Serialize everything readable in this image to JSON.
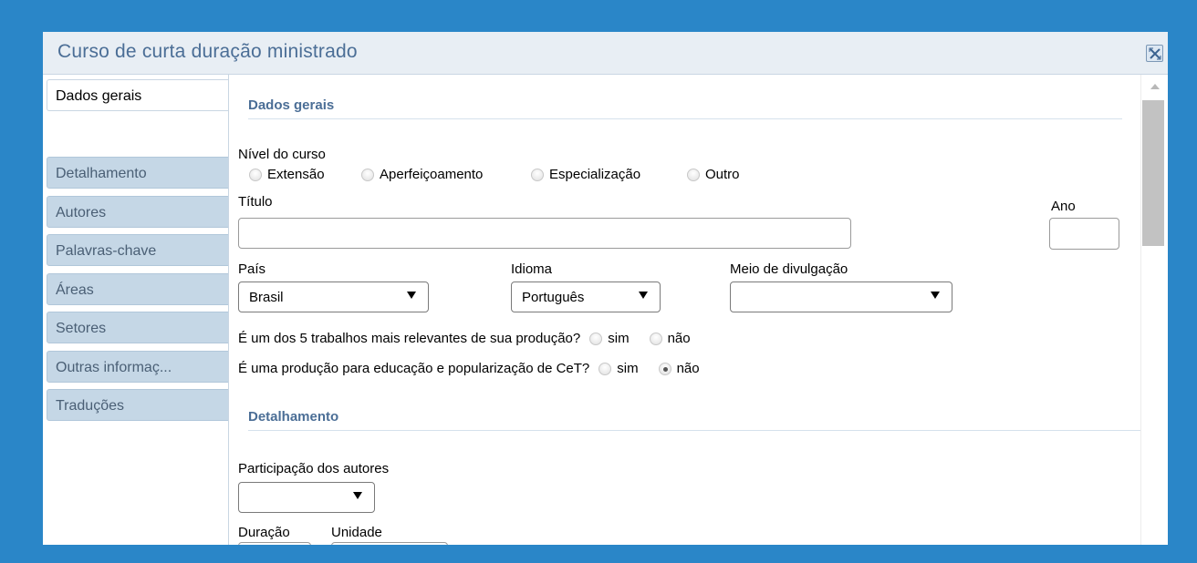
{
  "window": {
    "title": "Curso de curta duração ministrado"
  },
  "sidebar": {
    "tabs": [
      {
        "label": "Dados gerais"
      },
      {
        "label": "Detalhamento"
      },
      {
        "label": "Autores"
      },
      {
        "label": "Palavras-chave"
      },
      {
        "label": "Áreas"
      },
      {
        "label": "Setores"
      },
      {
        "label": "Outras informaç..."
      },
      {
        "label": "Traduções"
      }
    ]
  },
  "dados_gerais": {
    "section_title": "Dados gerais",
    "nivel": {
      "label": "Nível do curso",
      "options": [
        "Extensão",
        "Aperfeiçoamento",
        "Especialização",
        "Outro"
      ]
    },
    "titulo": {
      "label": "Título",
      "value": ""
    },
    "ano": {
      "label": "Ano",
      "value": ""
    },
    "pais": {
      "label": "País",
      "value": "Brasil"
    },
    "idioma": {
      "label": "Idioma",
      "value": "Português"
    },
    "meio": {
      "label": "Meio de divulgação",
      "value": ""
    },
    "relevantes": {
      "question": "É um dos 5 trabalhos mais relevantes de sua produção?",
      "yes": "sim",
      "no": "não",
      "selected": null
    },
    "educacao": {
      "question": "É uma produção para educação e popularização de CeT?",
      "yes": "sim",
      "no": "não",
      "selected": "não"
    }
  },
  "detalhamento": {
    "section_title": "Detalhamento",
    "participacao": {
      "label": "Participação dos autores",
      "value": ""
    },
    "duracao": {
      "label": "Duração"
    },
    "unidade": {
      "label": "Unidade"
    }
  }
}
